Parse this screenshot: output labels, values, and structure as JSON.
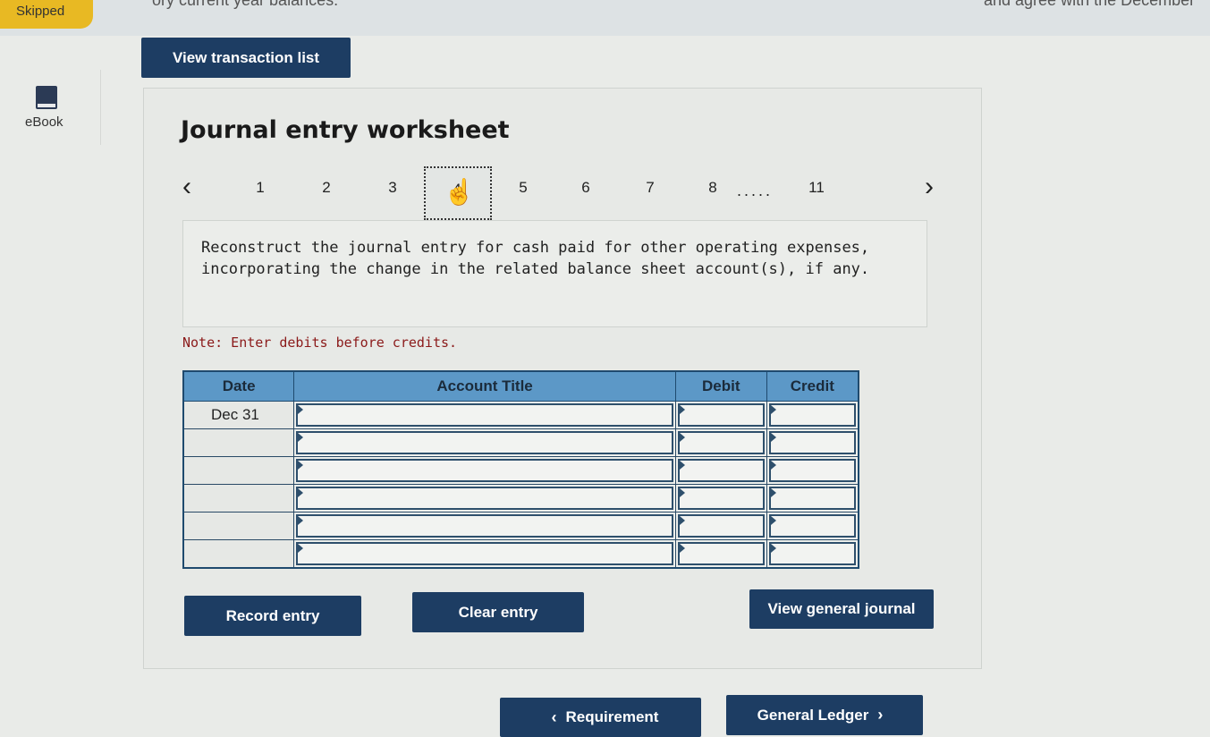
{
  "top": {
    "skipped_label": "Skipped",
    "cut_text_left": "ory current year balances.",
    "cut_text_right": "and agree with the December"
  },
  "sidebar": {
    "ebook_label": "eBook"
  },
  "buttons": {
    "view_transaction_list": "View transaction list",
    "record_entry": "Record entry",
    "clear_entry": "Clear entry",
    "view_general_journal": "View general journal",
    "requirement": "Requirement",
    "general_ledger": "General Ledger"
  },
  "worksheet": {
    "title": "Journal entry worksheet",
    "pages": [
      "1",
      "2",
      "3",
      "4",
      "5",
      "6",
      "7",
      "8",
      "11"
    ],
    "current_page": "4",
    "ellipsis": ".....",
    "instruction": "Reconstruct the journal entry for cash paid for other operating expenses, incorporating the change in the related balance sheet account(s), if any.",
    "note": "Note: Enter debits before credits."
  },
  "table": {
    "headers": [
      "Date",
      "Account Title",
      "Debit",
      "Credit"
    ],
    "rows": [
      "Dec 31",
      "",
      "",
      "",
      "",
      ""
    ]
  },
  "colors": {
    "button_bg": "#1d3d63",
    "header_bg": "#5c98c7",
    "skipped_bg": "#e8b923",
    "note_text": "#8b1a1a"
  },
  "icons": [
    "book-icon",
    "hand-pointer-icon",
    "chevron-left-icon",
    "chevron-right-icon"
  ]
}
